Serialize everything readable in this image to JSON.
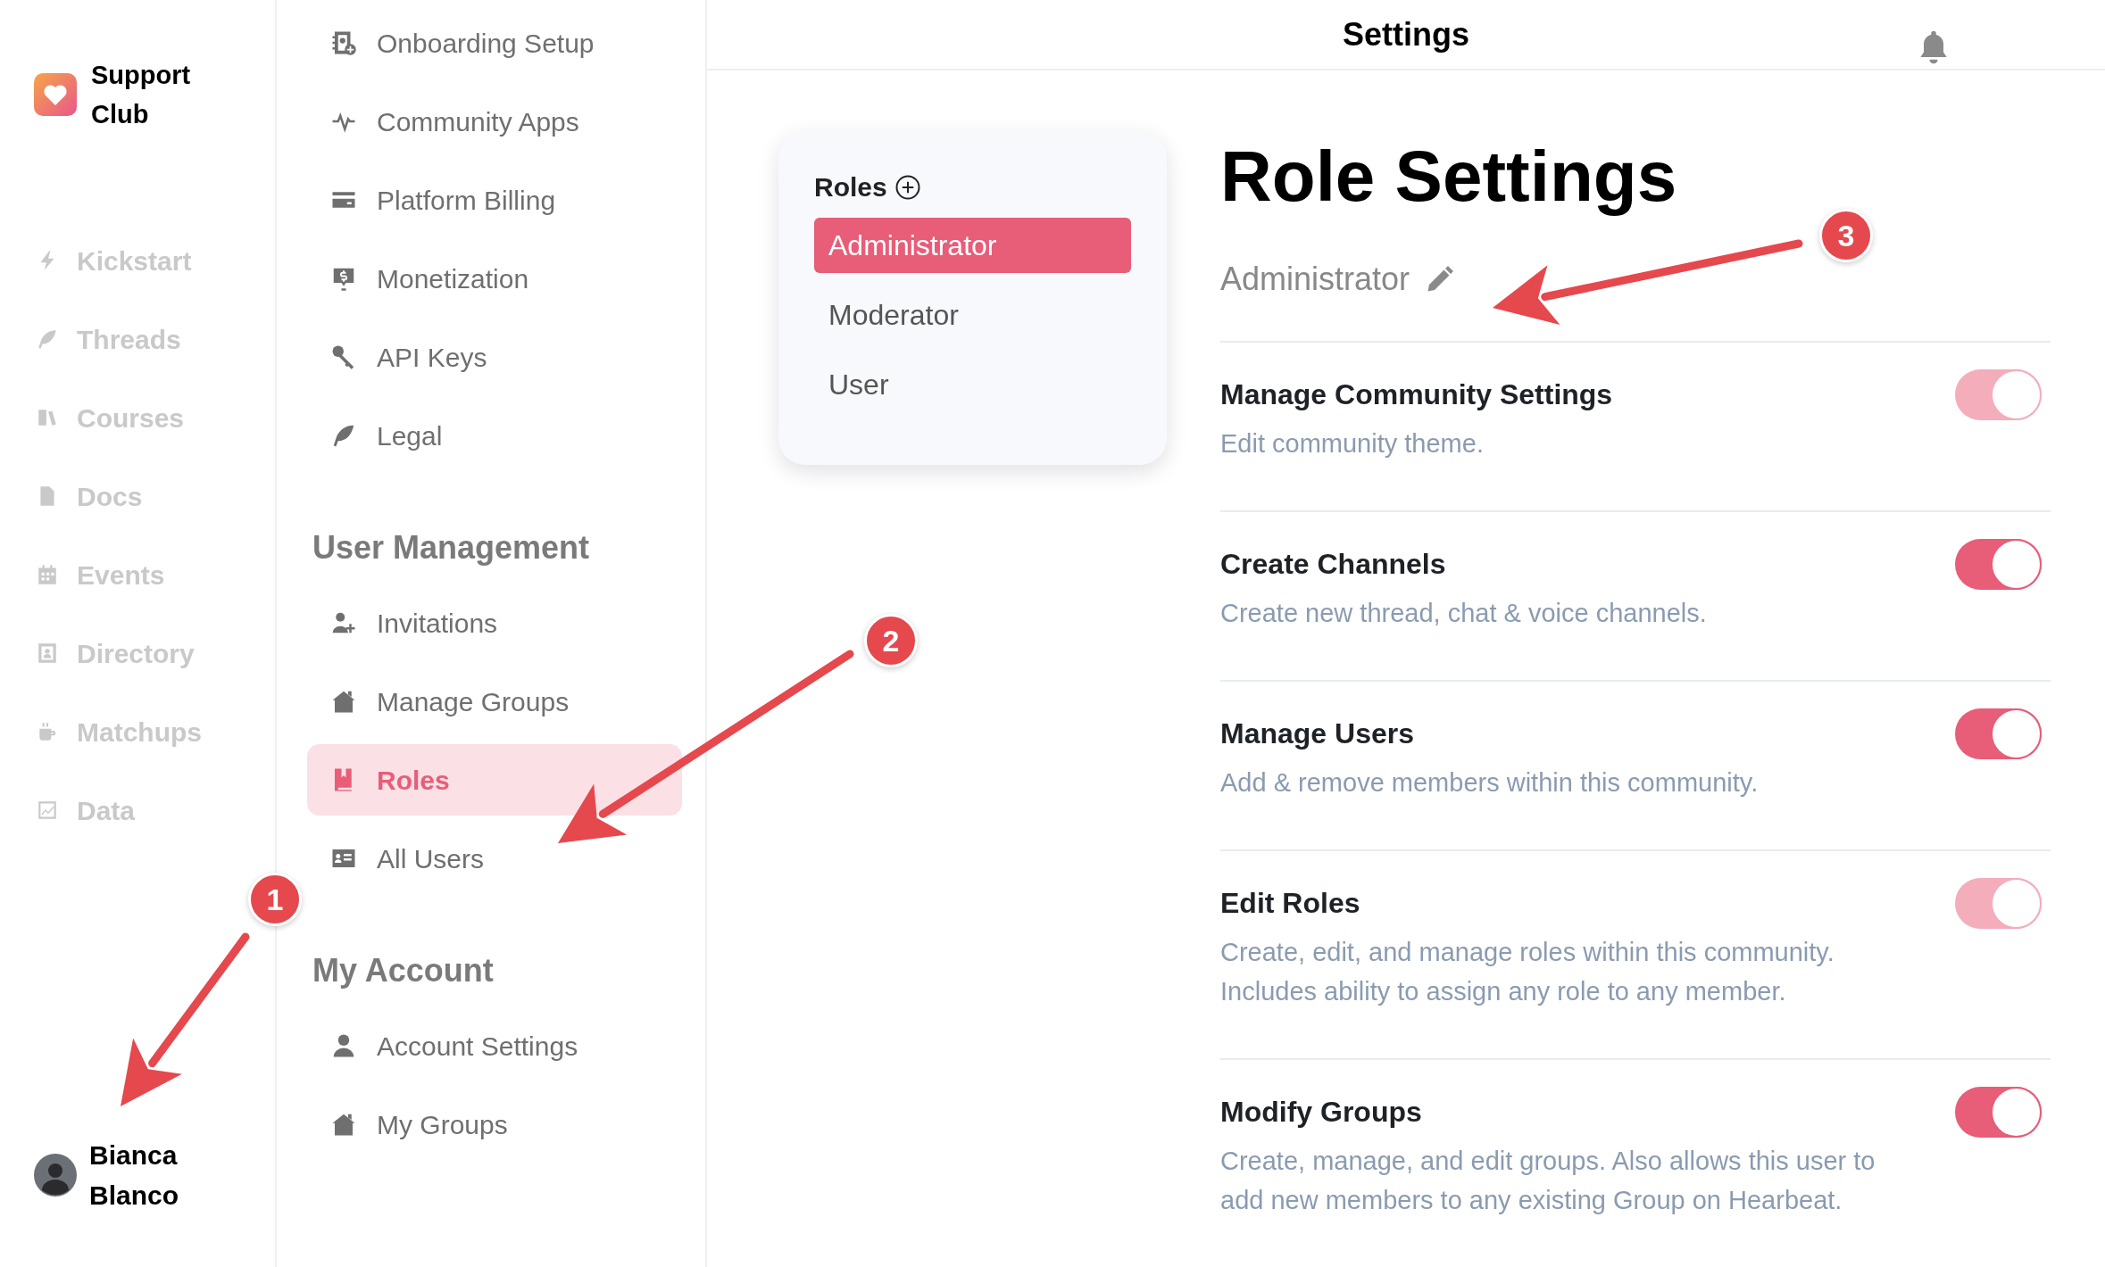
{
  "brand": {
    "name": "Support Club"
  },
  "main_nav": [
    {
      "label": "Kickstart"
    },
    {
      "label": "Threads"
    },
    {
      "label": "Courses"
    },
    {
      "label": "Docs"
    },
    {
      "label": "Events"
    },
    {
      "label": "Directory"
    },
    {
      "label": "Matchups"
    },
    {
      "label": "Data"
    }
  ],
  "user": {
    "name": "Bianca Blanco"
  },
  "settings_nav": {
    "items": [
      {
        "label": "Onboarding Setup",
        "selected": false
      },
      {
        "label": "Community Apps",
        "selected": false
      },
      {
        "label": "Platform Billing",
        "selected": false
      },
      {
        "label": "Monetization",
        "selected": false
      },
      {
        "label": "API Keys",
        "selected": false
      },
      {
        "label": "Legal",
        "selected": false
      }
    ],
    "sections": [
      {
        "title": "User Management",
        "items": [
          {
            "label": "Invitations",
            "selected": false
          },
          {
            "label": "Manage Groups",
            "selected": false
          },
          {
            "label": "Roles",
            "selected": true
          },
          {
            "label": "All Users",
            "selected": false
          }
        ]
      },
      {
        "title": "My Account",
        "items": [
          {
            "label": "Account Settings",
            "selected": false
          },
          {
            "label": "My Groups",
            "selected": false
          }
        ]
      }
    ]
  },
  "header": {
    "title": "Settings"
  },
  "roles_panel": {
    "title": "Roles",
    "roles": [
      {
        "name": "Administrator",
        "selected": true
      },
      {
        "name": "Moderator",
        "selected": false
      },
      {
        "name": "User",
        "selected": false
      }
    ]
  },
  "role_settings": {
    "title": "Role Settings",
    "role_name": "Administrator",
    "permissions": [
      {
        "title": "Manage Community Settings",
        "description": "Edit community theme.",
        "on": true,
        "disabled": true
      },
      {
        "title": "Create Channels",
        "description": "Create new thread, chat & voice channels.",
        "on": true,
        "disabled": false
      },
      {
        "title": "Manage Users",
        "description": "Add & remove members within this community.",
        "on": true,
        "disabled": false
      },
      {
        "title": "Edit Roles",
        "description": "Create, edit, and manage roles within this community. Includes ability to assign any role to any member.",
        "on": true,
        "disabled": true
      },
      {
        "title": "Modify Groups",
        "description": "Create, manage, and edit groups. Also allows this user to add new members to any existing Group on Hearbeat.",
        "on": true,
        "disabled": false
      }
    ]
  },
  "annotations": [
    {
      "number": "1"
    },
    {
      "number": "2"
    },
    {
      "number": "3"
    }
  ]
}
